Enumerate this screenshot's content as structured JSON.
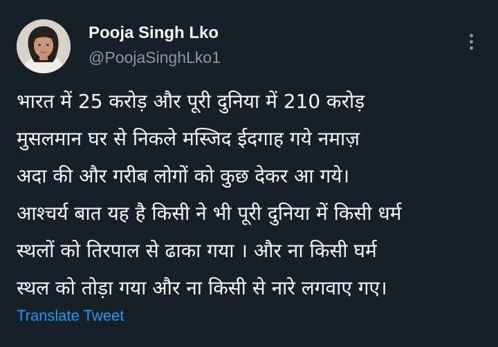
{
  "author": {
    "display_name": "Pooja Singh Lko",
    "handle": "@PoojaSinghLko1",
    "avatar_icon": "profile-photo"
  },
  "menu": {
    "icon": "more-vertical-icon"
  },
  "tweet": {
    "lines": [
      "भारत में 25 करोड़ और पूरी दुनिया में 210 करोड़",
      "मुसलमान घर से निकले मस्जिद ईदगाह गये नमाज़",
      "अदा की और गरीब लोगों को कुछ देकर आ गये।",
      "आश्चर्य बात यह है  किसी ने भी पूरी दुनिया में किसी धर्म",
      "स्थलों को तिरपाल से ढाका गया । और ना  किसी घर्म",
      "स्थल को तोड़ा गया और ना किसी से नारे लगवाए गए।"
    ]
  },
  "actions": {
    "translate_label": "Translate Tweet"
  },
  "colors": {
    "background": "#15202b",
    "primary_text": "#f7f9f9",
    "secondary_text": "#8b98a5",
    "link": "#1d9bf0"
  }
}
